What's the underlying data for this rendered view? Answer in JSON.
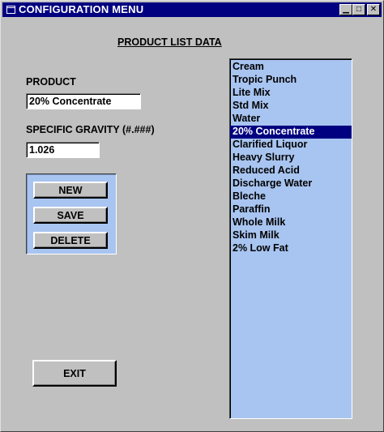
{
  "window": {
    "title": "CONFIGURATION MENU",
    "controls": {
      "minimize": "▁",
      "maximize": "□",
      "close": "✕"
    }
  },
  "heading": "PRODUCT LIST DATA",
  "form": {
    "product_label": "PRODUCT",
    "product_value": "20% Concentrate",
    "gravity_label": "SPECIFIC GRAVITY (#.###)",
    "gravity_value": "1.026"
  },
  "buttons": {
    "new": "NEW",
    "save": "SAVE",
    "delete": "DELETE",
    "exit": "EXIT"
  },
  "product_list": {
    "items": [
      "Cream",
      "Tropic Punch",
      "Lite Mix",
      "Std Mix",
      "Water",
      "20% Concentrate",
      "Clarified Liquor",
      "Heavy Slurry",
      "Reduced Acid",
      "Discharge Water",
      "Bleche",
      "Paraffin",
      "Whole Milk",
      "Skim Milk",
      "2% Low Fat"
    ],
    "selected": "20% Concentrate"
  },
  "colors": {
    "titlebar": "#000080",
    "panel": "#a8c4f0",
    "face": "#c0c0c0",
    "selection": "#000080"
  }
}
